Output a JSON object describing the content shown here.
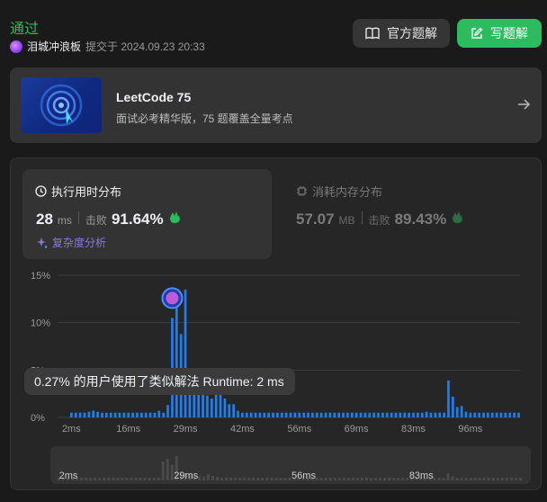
{
  "header": {
    "status": "通过",
    "username": "泪城冲浪板",
    "submitted_at": "提交于 2024.09.23 20:33",
    "official_solution_btn": "官方题解",
    "write_solution_btn": "写题解"
  },
  "promo": {
    "title": "LeetCode 75",
    "subtitle": "面试必考精华版，75 题覆盖全量考点"
  },
  "runtime": {
    "header": "执行用时分布",
    "value": "28",
    "unit": "ms",
    "beat_label": "击败",
    "beat_pct": "91.64%",
    "analysis": "复杂度分析"
  },
  "memory": {
    "header": "消耗内存分布",
    "value": "57.07",
    "unit": "MB",
    "beat_label": "击败",
    "beat_pct": "89.43%"
  },
  "tooltip": "0.27% 的用户使用了类似解法 Runtime: 2 ms",
  "colors": {
    "accent_green": "#2cbb5d",
    "bar_blue": "#1d7ff0",
    "analysis_purple": "#8a7bd9"
  },
  "icons": [
    "book-icon",
    "edit-icon",
    "arrow-right-icon",
    "clock-icon",
    "chip-icon",
    "sparkle-icon",
    "clap-icon"
  ],
  "chart_data": {
    "type": "bar",
    "ylabel_ticks": [
      "15%",
      "10%",
      "5%",
      "0%"
    ],
    "ylim": [
      0,
      15
    ],
    "xtick_labels": [
      "2ms",
      "16ms",
      "29ms",
      "42ms",
      "56ms",
      "69ms",
      "83ms",
      "96ms"
    ],
    "selected_bar_index": 23,
    "values": [
      0.5,
      0.5,
      0.5,
      0.5,
      0.6,
      0.7,
      0.6,
      0.5,
      0.5,
      0.5,
      0.5,
      0.5,
      0.5,
      0.5,
      0.5,
      0.5,
      0.5,
      0.5,
      0.5,
      0.5,
      0.7,
      0.5,
      1.3,
      10.5,
      12.0,
      8.8,
      13.5,
      4.8,
      4.0,
      3.5,
      2.5,
      2.3,
      2.0,
      3.2,
      2.5,
      2.0,
      1.4,
      1.4,
      0.7,
      0.5,
      0.5,
      0.5,
      0.5,
      0.5,
      0.5,
      0.5,
      0.5,
      0.5,
      0.5,
      0.5,
      0.5,
      0.5,
      0.5,
      0.5,
      0.5,
      0.5,
      0.5,
      0.5,
      0.5,
      0.5,
      0.5,
      0.5,
      0.5,
      0.5,
      0.5,
      0.5,
      0.5,
      0.5,
      0.5,
      0.5,
      0.5,
      0.5,
      0.5,
      0.5,
      0.5,
      0.5,
      0.5,
      0.5,
      0.5,
      0.5,
      0.5,
      0.6,
      0.5,
      0.5,
      0.5,
      0.5,
      3.9,
      2.2,
      1.1,
      1.2,
      0.6,
      0.5,
      0.5,
      0.5,
      0.5,
      0.5,
      0.5,
      0.5,
      0.5,
      0.5,
      0.5,
      0.5,
      0.5
    ],
    "mini_xtick_labels": [
      "2ms",
      "29ms",
      "56ms",
      "83ms"
    ],
    "grid": true
  }
}
